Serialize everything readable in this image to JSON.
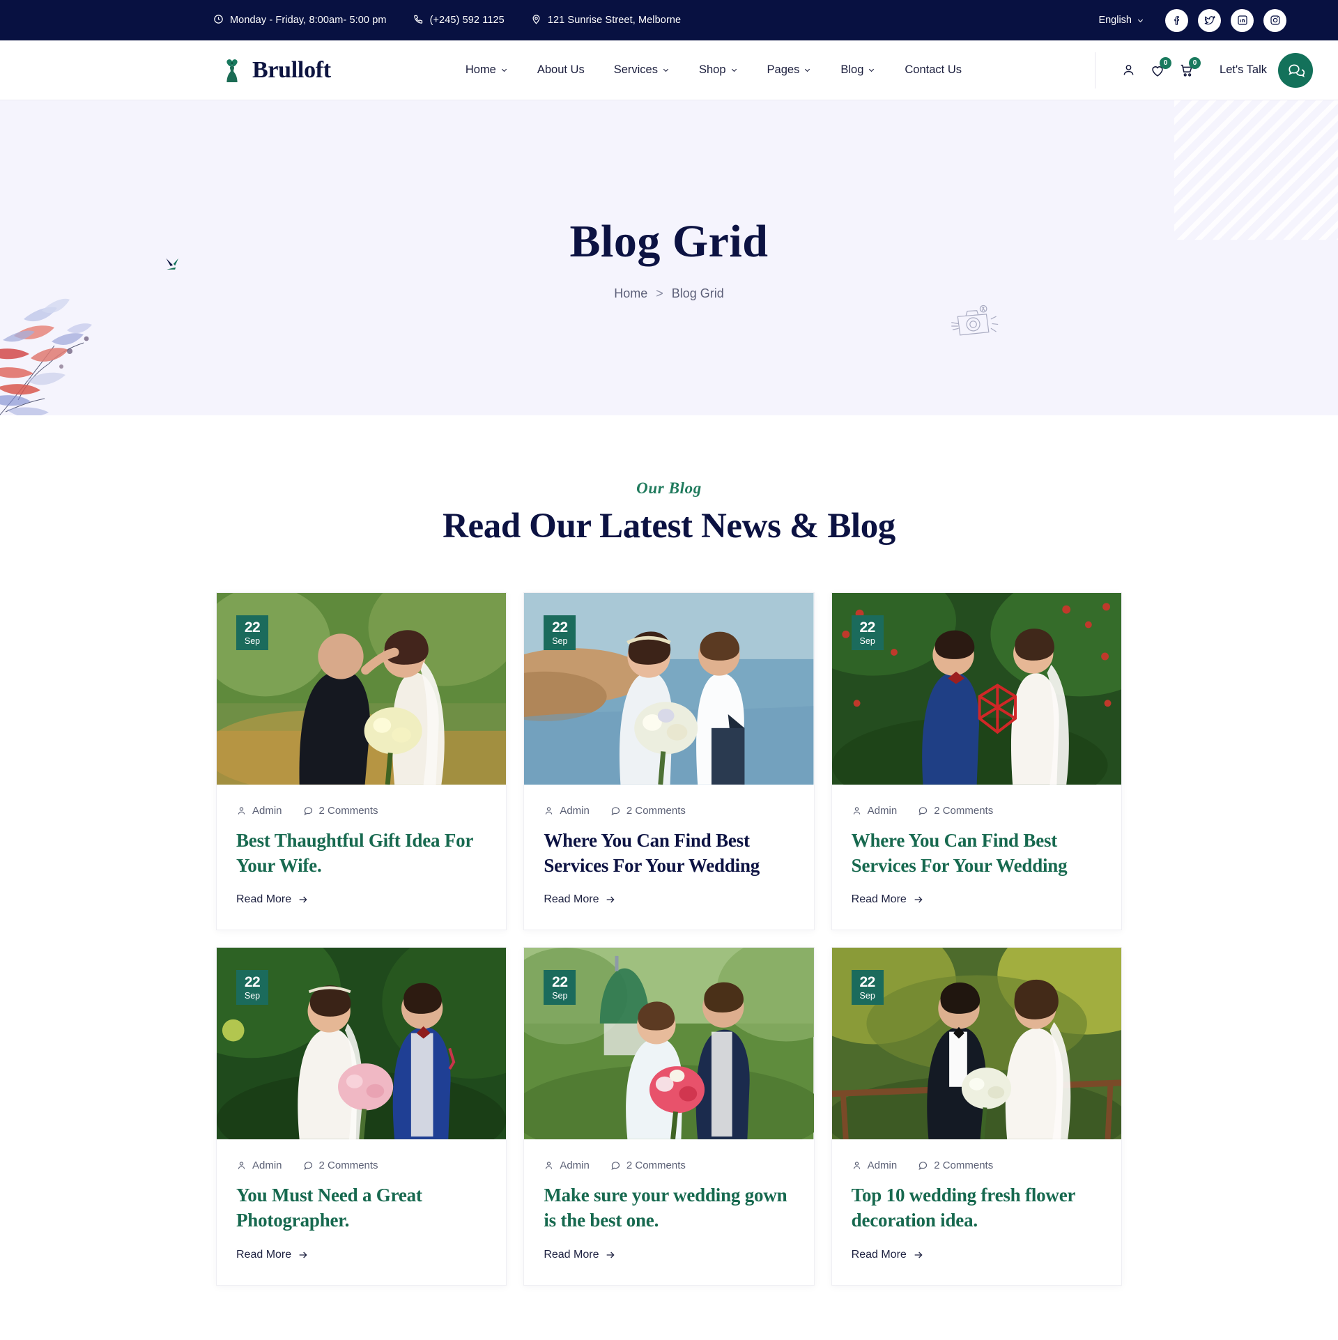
{
  "topbar": {
    "hours": "Monday - Friday, 8:00am- 5:00 pm",
    "phone": "(+245) 592 1125",
    "address": "121 Sunrise Street, Melborne",
    "language": "English",
    "icons": {
      "clock": "clock-icon",
      "phone": "phone-icon",
      "pin": "location-pin-icon",
      "chevron": "chevron-down-icon"
    },
    "socials": [
      {
        "name": "facebook-icon",
        "label": "Facebook"
      },
      {
        "name": "twitter-icon",
        "label": "Twitter"
      },
      {
        "name": "linkedin-icon",
        "label": "LinkedIn"
      },
      {
        "name": "instagram-icon",
        "label": "Instagram"
      }
    ]
  },
  "header": {
    "brand": "Brulloft",
    "nav": [
      {
        "label": "Home",
        "caret": true
      },
      {
        "label": "About Us",
        "caret": false
      },
      {
        "label": "Services",
        "caret": true
      },
      {
        "label": "Shop",
        "caret": true
      },
      {
        "label": "Pages",
        "caret": true
      },
      {
        "label": "Blog",
        "caret": true
      },
      {
        "label": "Contact Us",
        "caret": false
      }
    ],
    "wishlist_count": "0",
    "cart_count": "0",
    "lets_talk": "Let's Talk"
  },
  "hero": {
    "title": "Blog Grid",
    "breadcrumb_home": "Home",
    "breadcrumb_sep": ">",
    "breadcrumb_current": "Blog Grid"
  },
  "section": {
    "subtitle": "Our Blog",
    "title": "Read Our Latest News & Blog"
  },
  "posts": [
    {
      "day": "22",
      "month": "Sep",
      "author": "Admin",
      "comments": "2 Comments",
      "title": "Best Thaughtful Gift Idea For Your Wife.",
      "title_color": "green",
      "read_more": "Read More",
      "image_alt": "groom-and-bride-kissing-in-forest"
    },
    {
      "day": "22",
      "month": "Sep",
      "author": "Admin",
      "comments": "2 Comments",
      "title": "Where You Can Find Best Services For Your Wedding",
      "title_color": "navy",
      "read_more": "Read More",
      "image_alt": "couple-by-the-sea-with-bouquet"
    },
    {
      "day": "22",
      "month": "Sep",
      "author": "Admin",
      "comments": "2 Comments",
      "title": "Where You Can Find Best Services For Your Wedding",
      "title_color": "green",
      "read_more": "Read More",
      "image_alt": "couple-holding-red-heart-in-garden"
    },
    {
      "day": "22",
      "month": "Sep",
      "author": "Admin",
      "comments": "2 Comments",
      "title": "You Must Need a Great Photographer.",
      "title_color": "green",
      "read_more": "Read More",
      "image_alt": "bride-and-groom-in-blue-suit-by-hedge"
    },
    {
      "day": "22",
      "month": "Sep",
      "author": "Admin",
      "comments": "2 Comments",
      "title": "Make sure your wedding gown is the best one.",
      "title_color": "green",
      "read_more": "Read More",
      "image_alt": "couple-embracing-on-lawn"
    },
    {
      "day": "22",
      "month": "Sep",
      "author": "Admin",
      "comments": "2 Comments",
      "title": "Top 10 wedding fresh flower decoration idea.",
      "title_color": "green",
      "read_more": "Read More",
      "image_alt": "couple-on-wooden-bridge-in-autumn"
    }
  ],
  "colors": {
    "navy": "#081141",
    "green": "#17694f",
    "badge_green": "#1b6b5c",
    "hero_bg": "#f5f4fd",
    "accent_green": "#13715a"
  }
}
